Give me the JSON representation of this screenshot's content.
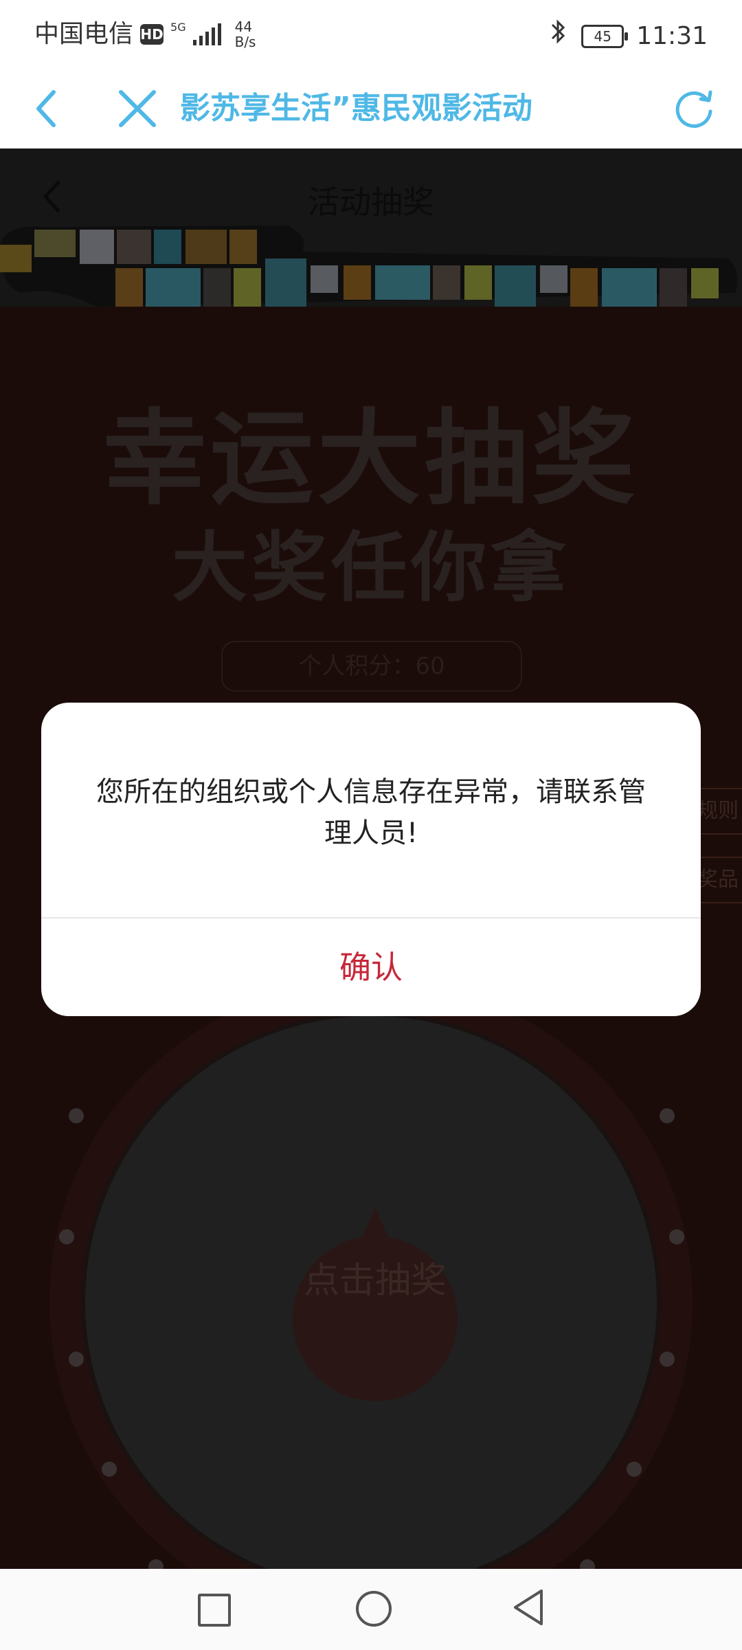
{
  "status_bar": {
    "carrier": "中国电信",
    "hd_badge": "HD",
    "network": "5G",
    "net_speed_value": "44",
    "net_speed_unit": "B/s",
    "battery": "45",
    "time": "11:31"
  },
  "browser_nav": {
    "title": "影苏享生活”惠民观影活动"
  },
  "page": {
    "title": "活动抽奖",
    "headline": "幸运大抽奖",
    "subheadline": "大奖任你拿",
    "points_text": "个人积分：60",
    "side_tab_1": "规则",
    "side_tab_2": "奖品",
    "wheel_center": "点击抽奖"
  },
  "dialog": {
    "message": "您所在的组织或个人信息存在异常，请联系管理人员!",
    "confirm_label": "确认"
  },
  "colors": {
    "accent": "#4fb8e6",
    "confirm": "#c6283a"
  }
}
